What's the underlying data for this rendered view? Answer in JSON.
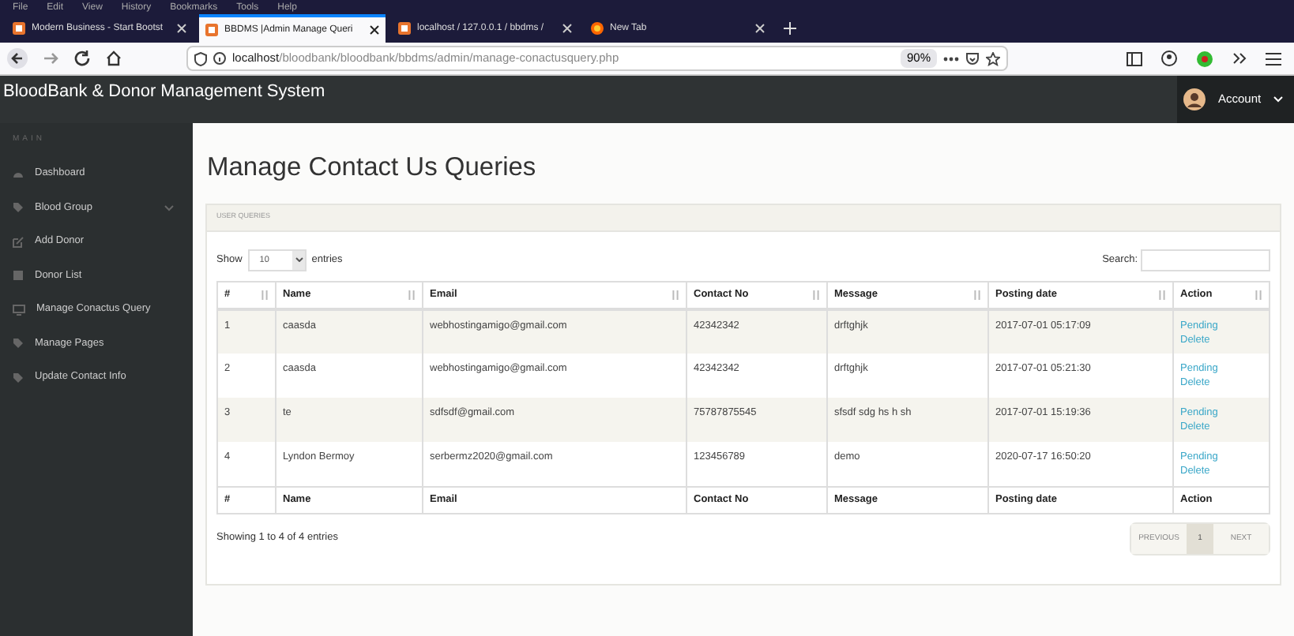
{
  "menu_bar": [
    "File",
    "Edit",
    "View",
    "History",
    "Bookmarks",
    "Tools",
    "Help"
  ],
  "browser_tabs": [
    {
      "label": "Modern Business - Start Bootst",
      "selected": false
    },
    {
      "label": "BBDMS |Admin Manage Queri",
      "selected": true
    },
    {
      "label": "localhost / 127.0.0.1 / bbdms /",
      "selected": false
    },
    {
      "label": "New Tab",
      "selected": false
    }
  ],
  "address_bar": {
    "host": "localhost",
    "path": "/bloodbank/bloodbank/bbdms/admin/manage-conactusquery.php",
    "zoom": "90%"
  },
  "header": {
    "title": "BloodBank & Donor Management System",
    "account": "Account"
  },
  "sidebar": {
    "section": "MAIN",
    "items": [
      {
        "label": "Dashboard",
        "expandable": false
      },
      {
        "label": "Blood Group",
        "expandable": true
      },
      {
        "label": "Add Donor",
        "expandable": false
      },
      {
        "label": "Donor List",
        "expandable": false
      },
      {
        "label": "Manage Conactus Query",
        "expandable": false
      },
      {
        "label": "Manage Pages",
        "expandable": false
      },
      {
        "label": "Update Contact Info",
        "expandable": false
      }
    ]
  },
  "page_title": "Manage Contact Us Queries",
  "panel": {
    "heading": "USER QUERIES",
    "show_label": "Show",
    "page_size": "10",
    "entries_label": "entries",
    "search_label": "Search:"
  },
  "table": {
    "columns": [
      "#",
      "Name",
      "Email",
      "Contact No",
      "Message",
      "Posting date",
      "Action"
    ],
    "rows": [
      {
        "cells": [
          "1",
          "caasda",
          "webhostingamigo@gmail.com",
          "42342342",
          "drftghjk",
          "2017-07-01 05:17:09"
        ],
        "actions": [
          "Pending",
          "Delete"
        ]
      },
      {
        "cells": [
          "2",
          "caasda",
          "webhostingamigo@gmail.com",
          "42342342",
          "drftghjk",
          "2017-07-01 05:21:30"
        ],
        "actions": [
          "Pending",
          "Delete"
        ]
      },
      {
        "cells": [
          "3",
          "te",
          "sdfsdf@gmail.com",
          "75787875545",
          "sfsdf sdg hs h sh",
          "2017-07-01 15:19:36"
        ],
        "actions": [
          "Pending",
          "Delete"
        ]
      },
      {
        "cells": [
          "4",
          "Lyndon Bermoy",
          "serbermz2020@gmail.com",
          "123456789",
          "demo",
          "2020-07-17 16:50:20"
        ],
        "actions": [
          "Pending",
          "Delete"
        ]
      }
    ],
    "footer": [
      "#",
      "Name",
      "Email",
      "Contact No",
      "Message",
      "Posting date",
      "Action"
    ]
  },
  "info": "Showing 1 to 4 of 4 entries",
  "pagination": [
    {
      "label": "PREVIOUS",
      "selected": false
    },
    {
      "label": "1",
      "selected": true
    },
    {
      "label": "NEXT",
      "selected": false
    }
  ]
}
